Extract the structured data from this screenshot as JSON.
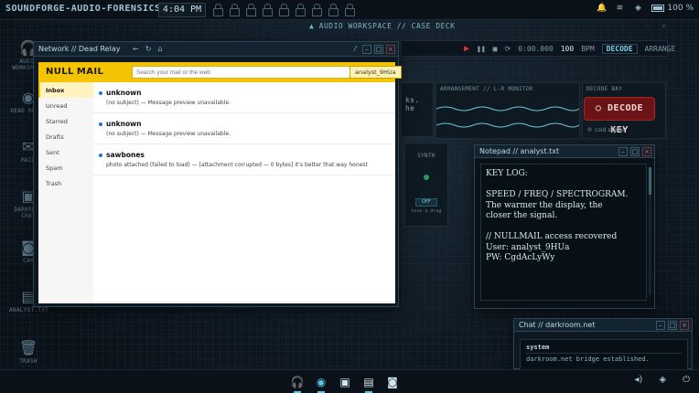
{
  "topbar": {
    "brand": "SOUNDFORGE-AUDIO-FORENSICS",
    "clock": "4:04 PM",
    "battery": "100 %"
  },
  "desktop": [
    {
      "label": "AUDIO WORKSPACE",
      "icon": "headphones-icon",
      "glyph": "🎧"
    },
    {
      "label": "DEAD RELAY",
      "icon": "globe-icon",
      "glyph": "◉"
    },
    {
      "label": "MAIL",
      "icon": "mail-icon",
      "glyph": "✉"
    },
    {
      "label": "DARKROOM CHAT",
      "icon": "chat-icon",
      "glyph": "▣"
    },
    {
      "label": "CAM",
      "icon": "camera-icon",
      "glyph": "◙"
    },
    {
      "label": "ANALYST.TXT",
      "icon": "notepad-icon",
      "glyph": "▤"
    },
    {
      "label": "TRASH",
      "icon": "trash-icon",
      "glyph": "🗑"
    }
  ],
  "workspace": {
    "title": "AUDIO WORKSPACE // CASE DECK",
    "time": "0:00.000",
    "bpm": "100",
    "bpm_unit": "BPM",
    "tab_decode": "DECODE",
    "tab_arrange": "ARRANGE",
    "arrangement_label": "ARRANGEMENT // L-R MONITOR",
    "decode_bay_label": "DECODE BAY",
    "decode_button": "DECODE KEY",
    "cold_signal": "cold signal",
    "synth_label": "SYNTH",
    "synth_toggle": "OFF",
    "synth_small": "tone a drag",
    "partial_text": "ks. he"
  },
  "mail": {
    "window_title": "Network // Dead Relay",
    "logo_null": "NULL",
    "logo_mail": "MAIL",
    "search_placeholder": "Search your mail or the web",
    "account": "analyst_9HUa",
    "folders": [
      "Inbox",
      "Unread",
      "Starred",
      "Drafts",
      "Sent",
      "Spam",
      "Trash"
    ],
    "messages": [
      {
        "from": "unknown",
        "preview": "(no subject) — Message preview unavailable."
      },
      {
        "from": "unknown",
        "preview": "(no subject) — Message preview unavailable."
      },
      {
        "from": "sawbones",
        "preview": "photo attached (failed to load) — [attachment corrupted — 0 bytes] it's better that way honest"
      }
    ]
  },
  "notepad": {
    "title": "Notepad // analyst.txt",
    "lines": [
      "KEY LOG:",
      "",
      "SPEED / FREQ / SPECTROGRAM.",
      "The warmer the display, the",
      "closer the signal.",
      "",
      "// NULLMAIL access recovered",
      "User: analyst_9HUa",
      "PW: CgdAcLyWy"
    ]
  },
  "chat": {
    "title": "Chat // darkroom.net",
    "sender": "system",
    "message": "darkroom.net bridge established."
  }
}
